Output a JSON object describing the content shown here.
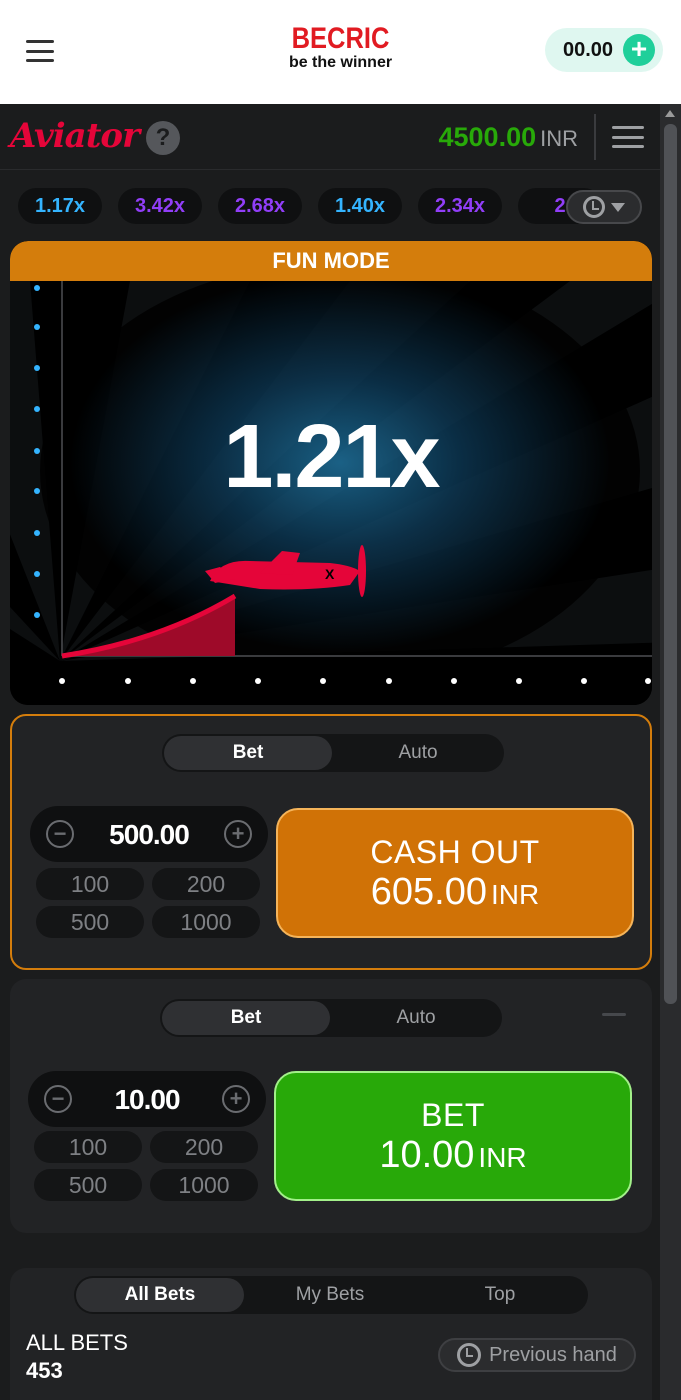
{
  "site": {
    "brand": "BECRIC",
    "tagline": "be the winner",
    "wallet_balance": "00.00"
  },
  "game": {
    "logo": "Aviator",
    "help": "?",
    "balance": "4500.00",
    "currency": "INR"
  },
  "history": [
    {
      "value": "1.17x",
      "color": "#34b4ff"
    },
    {
      "value": "3.42x",
      "color": "#913ef8"
    },
    {
      "value": "2.68x",
      "color": "#913ef8"
    },
    {
      "value": "1.40x",
      "color": "#34b4ff"
    },
    {
      "value": "2.34x",
      "color": "#913ef8"
    },
    {
      "value": "2",
      "color": "#913ef8"
    }
  ],
  "stage": {
    "banner": "FUN MODE",
    "multiplier": "1.21x"
  },
  "panel1": {
    "tab_bet": "Bet",
    "tab_auto": "Auto",
    "amount": "500.00",
    "quick": [
      "100",
      "200",
      "500",
      "1000"
    ],
    "button_line1": "CASH OUT",
    "button_amount": "605.00",
    "button_currency": "INR"
  },
  "panel2": {
    "tab_bet": "Bet",
    "tab_auto": "Auto",
    "amount": "10.00",
    "quick": [
      "100",
      "200",
      "500",
      "1000"
    ],
    "button_line1": "BET",
    "button_amount": "10.00",
    "button_currency": "INR"
  },
  "bets": {
    "tabs": [
      "All Bets",
      "My Bets",
      "Top"
    ],
    "title": "ALL BETS",
    "count": "453",
    "previous_hand": "Previous hand"
  },
  "colors": {
    "accent_red": "#e50539",
    "balance_green": "#28a909",
    "cashout_orange": "#d07206",
    "bet_green": "#28a909",
    "brand_red": "#e11b22"
  }
}
